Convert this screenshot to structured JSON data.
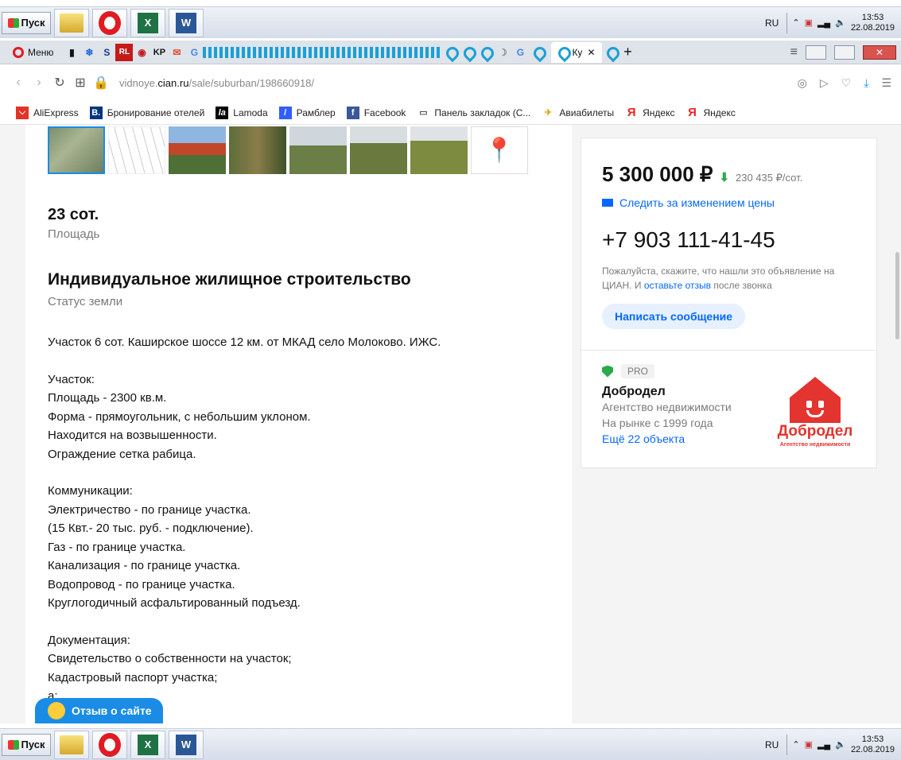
{
  "taskbar": {
    "start_label": "Пуск",
    "lang": "RU",
    "time": "13:53",
    "date": "22.08.2019",
    "icons": [
      "folder-icon",
      "opera-icon",
      "excel-icon",
      "word-icon"
    ]
  },
  "browser": {
    "menu_label": "Меню",
    "active_tab_label": "Ку",
    "url_prefix": "vidnoye.",
    "url_domain": "cian.ru",
    "url_path": "/sale/suburban/198660918/",
    "bookmarks": [
      {
        "label": "AliExpress",
        "color": "#e43225",
        "glyph": "⌵"
      },
      {
        "label": "Бронирование отелей",
        "color": "#003580",
        "glyph": "B."
      },
      {
        "label": "Lamoda",
        "color": "#000000",
        "glyph": "la"
      },
      {
        "label": "Рамблер",
        "color": "#315efb",
        "glyph": "/"
      },
      {
        "label": "Facebook",
        "color": "#3b5998",
        "glyph": "f"
      },
      {
        "label": "Панель закладок (С...",
        "color": "#ffffff",
        "glyph": "▭"
      },
      {
        "label": "Авиабилеты",
        "color": "#ffffff",
        "glyph": "✈"
      },
      {
        "label": "Яндекс",
        "color": "#ffffff",
        "glyph": "Я"
      },
      {
        "label": "Яндекс",
        "color": "#ffffff",
        "glyph": "Я"
      }
    ]
  },
  "listing": {
    "area_value": "23 сот.",
    "area_label": "Площадь",
    "status_value": "Индивидуальное жилищное строительство",
    "status_label": "Статус земли",
    "description_lines": [
      "Участок 6 сот. Каширское шоссе 12 км. от МКАД село Молоково. ИЖС.",
      "",
      "Участок:",
      "Площадь - 2300 кв.м.",
      "Форма - прямоугольник, с небольшим уклоном.",
      "Находится на возвышенности.",
      "Ограждение сетка рабица.",
      "",
      "Коммуникации:",
      "Электричество - по границе участка.",
      "(15 Квт.- 20 тыс. руб. - подключение).",
      "Газ - по границе участка.",
      "Канализация - по границе участка.",
      "Водопровод - по границе участка.",
      "Круглогодичный асфальтированный подъезд.",
      "",
      "Документация:",
      "Свидетельство о собственности на участок;",
      "Кадастровый паспорт участка;",
      "а;"
    ]
  },
  "sidebar": {
    "price": "5 300 000 ₽",
    "price_per_sotka": "230 435 ₽/сот.",
    "follow_price": "Следить за изменением цены",
    "phone": "+7 903 111-41-45",
    "hint_before": "Пожалуйста, скажите, что нашли это объявление на ЦИАН. И ",
    "hint_link": "оставьте отзыв",
    "hint_after": " после звонка",
    "message_button": "Написать сообщение",
    "agent": {
      "badge": "PRO",
      "name": "Добродел",
      "type": "Агентство недвижимости",
      "since": "На рынке с 1999 года",
      "objects_link": "Ещё 22 объекта",
      "logo_text": "Добродел",
      "logo_subtext": "Агентство недвижимости"
    }
  },
  "feedback_button": "Отзыв о сайте"
}
